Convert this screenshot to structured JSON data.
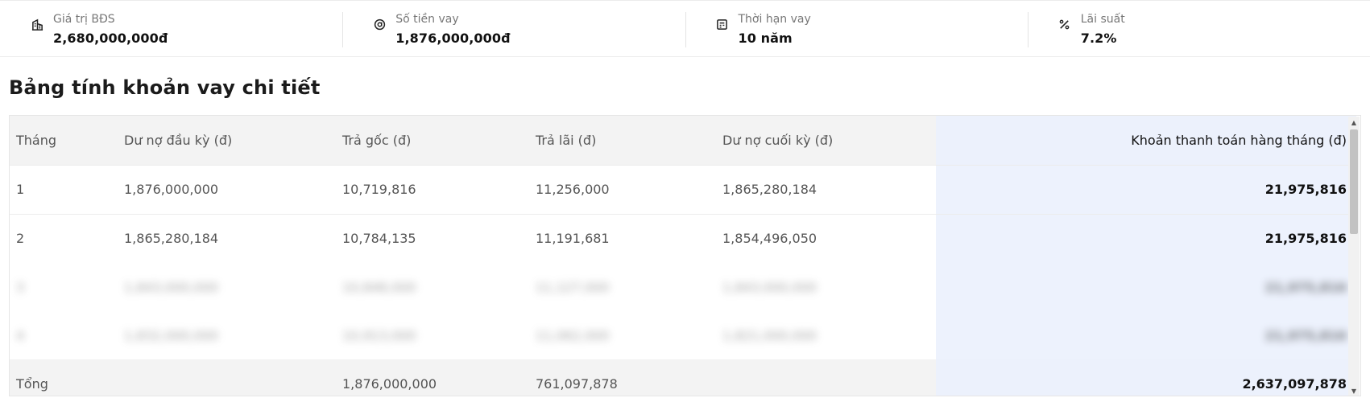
{
  "summary": [
    {
      "label": "Giá trị BĐS",
      "value": "2,680,000,000đ",
      "icon": "building-icon"
    },
    {
      "label": "Số tiền vay",
      "value": "1,876,000,000đ",
      "icon": "coin-icon"
    },
    {
      "label": "Thời hạn vay",
      "value": "10 năm",
      "icon": "calendar-icon"
    },
    {
      "label": "Lãi suất",
      "value": "7.2%",
      "icon": "percent-icon"
    }
  ],
  "title": "Bảng tính khoản vay chi tiết",
  "table": {
    "headers": [
      "Tháng",
      "Dư nợ đầu kỳ (đ)",
      "Trả gốc (đ)",
      "Trả lãi (đ)",
      "Dư nợ cuối kỳ (đ)",
      "Khoản thanh toán hàng tháng (đ)"
    ],
    "rows": [
      [
        "1",
        "1,876,000,000",
        "10,719,816",
        "11,256,000",
        "1,865,280,184",
        "21,975,816"
      ],
      [
        "2",
        "1,865,280,184",
        "10,784,135",
        "11,191,681",
        "1,854,496,050",
        "21,975,816"
      ]
    ],
    "footer": [
      "Tổng",
      "",
      "1,876,000,000",
      "761,097,878",
      "",
      "2,637,097,878"
    ]
  },
  "colors": {
    "accent_column": "#edf2fd",
    "header_bg": "#f3f3f3"
  }
}
